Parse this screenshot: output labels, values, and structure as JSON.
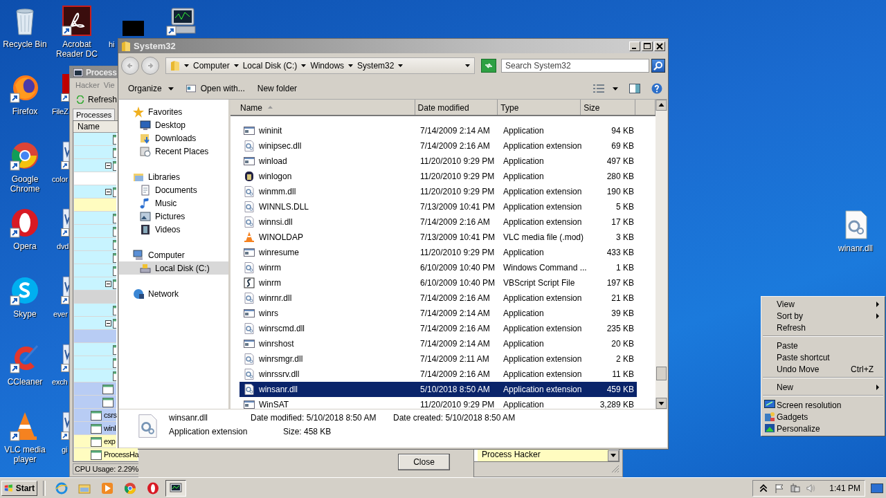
{
  "desktop_icons": [
    {
      "label": "Recycle Bin",
      "kind": "recycle",
      "shortcut": false
    },
    {
      "label": "Acrobat Reader DC",
      "kind": "acrobat",
      "shortcut": true
    },
    {
      "label": "hi",
      "kind": "blank",
      "shortcut": false
    },
    {
      "kind": "monitor",
      "shortcut": true
    },
    {
      "label": "Firefox",
      "kind": "firefox",
      "shortcut": true
    },
    {
      "label": "FileZ",
      "kind": "filezilla",
      "shortcut": true
    },
    {
      "label": "Google Chrome",
      "kind": "chrome",
      "shortcut": true
    },
    {
      "label": "color",
      "kind": "document",
      "shortcut": true
    },
    {
      "label": "Opera",
      "kind": "opera",
      "shortcut": true
    },
    {
      "label": "dvd",
      "kind": "document",
      "shortcut": true
    },
    {
      "label": "Skype",
      "kind": "skype",
      "shortcut": true
    },
    {
      "label": "ever",
      "kind": "document",
      "shortcut": true
    },
    {
      "label": "CCleaner",
      "kind": "ccleaner",
      "shortcut": true
    },
    {
      "label": "exch",
      "kind": "document",
      "shortcut": true
    },
    {
      "label": "VLC media player",
      "kind": "vlc",
      "shortcut": true
    },
    {
      "label": "gi",
      "kind": "document",
      "shortcut": true
    },
    {
      "label": "winanr.dll",
      "kind": "dll",
      "shortcut": false
    }
  ],
  "process_hacker": {
    "title": "Process",
    "menu": [
      "Hacker",
      "Vie"
    ],
    "toolbar": [
      "Refresh"
    ],
    "tabs": [
      {
        "label": "Processes",
        "selected": true
      }
    ],
    "column": "Name",
    "rows": [
      {
        "color": "#c8f4ff",
        "kind": "leaf",
        "icon": true
      },
      {
        "color": "#c8f4ff",
        "kind": "leaf",
        "icon": true
      },
      {
        "color": "#c8f4ff",
        "kind": "node",
        "icon": true
      },
      {
        "color": "#ffffff",
        "kind": "leaf",
        "icon": false
      },
      {
        "color": "#c8f4ff",
        "kind": "node",
        "icon": true
      },
      {
        "color": "#fffcc0",
        "kind": "leaf",
        "icon": false
      },
      {
        "color": "#c8f4ff",
        "kind": "leaf",
        "icon": true
      },
      {
        "color": "#c8f4ff",
        "kind": "leaf",
        "icon": true
      },
      {
        "color": "#c8f4ff",
        "kind": "leaf",
        "icon": true
      },
      {
        "color": "#c8f4ff",
        "kind": "leaf",
        "icon": true
      },
      {
        "color": "#c8f4ff",
        "kind": "leaf",
        "icon": true
      },
      {
        "color": "#c8f4ff",
        "kind": "node",
        "icon": true
      },
      {
        "color": "#d4d4d4",
        "kind": "leaf",
        "icon": false
      },
      {
        "color": "#c8f4ff",
        "kind": "leaf",
        "icon": true
      },
      {
        "color": "#c8f4ff",
        "kind": "node",
        "icon": true
      },
      {
        "color": "#b8ccf4",
        "kind": "leaf",
        "icon": false
      },
      {
        "color": "#c8f4ff",
        "kind": "leaf",
        "icon": true
      },
      {
        "color": "#c8f4ff",
        "kind": "leaf",
        "icon": true
      },
      {
        "color": "#c8f4ff",
        "kind": "leaf",
        "icon": true
      },
      {
        "color": "#b8ccf4",
        "kind": "leaf",
        "icon": true
      },
      {
        "color": "#b8ccf4",
        "kind": "leaf",
        "icon": true
      },
      {
        "color": "#b8ccf4",
        "kind": "leaf",
        "icon": true,
        "text": "csrs"
      },
      {
        "color": "#b8ccf4",
        "kind": "leaf",
        "icon": true,
        "text": "winl"
      },
      {
        "color": "#fffcc0",
        "kind": "leaf",
        "icon": true,
        "text": "exp"
      },
      {
        "color": "#fffcc0",
        "kind": "leaf",
        "icon": true,
        "text": "ProcessHa",
        "description": "Process Hacker"
      }
    ],
    "status": "CPU Usage: 2.29%"
  },
  "dialog": {
    "button": "Close"
  },
  "explorer": {
    "title": "System32",
    "breadcrumb": [
      "Computer",
      "Local Disk (C:)",
      "Windows",
      "System32"
    ],
    "search": {
      "placeholder": "Search System32"
    },
    "toolbar": [
      {
        "label": "Organize",
        "kind": "menu"
      },
      {
        "label": "Open with...",
        "kind": "open"
      },
      {
        "label": "New folder",
        "kind": "plain"
      }
    ],
    "nav": [
      {
        "label": "Favorites",
        "kind": "star",
        "selected": false,
        "children": [
          {
            "label": "Desktop",
            "kind": "desktop",
            "selected": false
          },
          {
            "label": "Downloads",
            "kind": "downloads",
            "selected": false
          },
          {
            "label": "Recent Places",
            "kind": "recent",
            "selected": false
          }
        ]
      },
      {
        "label": "Libraries",
        "kind": "libraries",
        "selected": false,
        "children": [
          {
            "label": "Documents",
            "kind": "documents",
            "selected": false
          },
          {
            "label": "Music",
            "kind": "music",
            "selected": false
          },
          {
            "label": "Pictures",
            "kind": "pictures",
            "selected": false
          },
          {
            "label": "Videos",
            "kind": "videos",
            "selected": false
          }
        ]
      },
      {
        "label": "Computer",
        "kind": "computer",
        "selected": false,
        "children": [
          {
            "label": "Local Disk (C:)",
            "kind": "disk",
            "selected": true
          }
        ]
      },
      {
        "label": "Network",
        "kind": "network",
        "selected": false
      }
    ],
    "columns": [
      {
        "label": "Name",
        "sorted": true
      },
      {
        "label": "Date modified",
        "sorted": false
      },
      {
        "label": "Type",
        "sorted": false
      },
      {
        "label": "Size",
        "sorted": false
      }
    ],
    "files": [
      {
        "name": "wininit",
        "date": "7/14/2009 2:14 AM",
        "type": "Application",
        "size": "94 KB",
        "kind": "application",
        "selected": false
      },
      {
        "name": "winipsec.dll",
        "date": "7/14/2009 2:16 AM",
        "type": "Application extension",
        "size": "69 KB",
        "kind": "extension",
        "selected": false
      },
      {
        "name": "winload",
        "date": "11/20/2010 9:29 PM",
        "type": "Application",
        "size": "497 KB",
        "kind": "application",
        "selected": false
      },
      {
        "name": "winlogon",
        "date": "11/20/2010 9:29 PM",
        "type": "Application",
        "size": "280 KB",
        "kind": "logon",
        "selected": false
      },
      {
        "name": "winmm.dll",
        "date": "11/20/2010 9:29 PM",
        "type": "Application extension",
        "size": "190 KB",
        "kind": "extension",
        "selected": false
      },
      {
        "name": "WINNLS.DLL",
        "date": "7/13/2009 10:41 PM",
        "type": "Application extension",
        "size": "5 KB",
        "kind": "extension",
        "selected": false
      },
      {
        "name": "winnsi.dll",
        "date": "7/14/2009 2:16 AM",
        "type": "Application extension",
        "size": "17 KB",
        "kind": "extension",
        "selected": false
      },
      {
        "name": "WINOLDAP",
        "date": "7/13/2009 10:41 PM",
        "type": "VLC media file (.mod)",
        "size": "3 KB",
        "kind": "media",
        "selected": false
      },
      {
        "name": "winresume",
        "date": "11/20/2010 9:29 PM",
        "type": "Application",
        "size": "433 KB",
        "kind": "application",
        "selected": false
      },
      {
        "name": "winrm",
        "date": "6/10/2009 10:40 PM",
        "type": "Windows Command ...",
        "size": "1 KB",
        "kind": "command",
        "selected": false
      },
      {
        "name": "winrm",
        "date": "6/10/2009 10:40 PM",
        "type": "VBScript Script File",
        "size": "197 KB",
        "kind": "script",
        "selected": false
      },
      {
        "name": "winrnr.dll",
        "date": "7/14/2009 2:16 AM",
        "type": "Application extension",
        "size": "21 KB",
        "kind": "extension",
        "selected": false
      },
      {
        "name": "winrs",
        "date": "7/14/2009 2:14 AM",
        "type": "Application",
        "size": "39 KB",
        "kind": "application",
        "selected": false
      },
      {
        "name": "winrscmd.dll",
        "date": "7/14/2009 2:16 AM",
        "type": "Application extension",
        "size": "235 KB",
        "kind": "extension",
        "selected": false
      },
      {
        "name": "winrshost",
        "date": "7/14/2009 2:14 AM",
        "type": "Application",
        "size": "20 KB",
        "kind": "application",
        "selected": false
      },
      {
        "name": "winrsmgr.dll",
        "date": "7/14/2009 2:11 AM",
        "type": "Application extension",
        "size": "2 KB",
        "kind": "extension",
        "selected": false
      },
      {
        "name": "winrssrv.dll",
        "date": "7/14/2009 2:16 AM",
        "type": "Application extension",
        "size": "11 KB",
        "kind": "extension",
        "selected": false
      },
      {
        "name": "winsanr.dll",
        "date": "5/10/2018 8:50 AM",
        "type": "Application extension",
        "size": "459 KB",
        "kind": "extension",
        "selected": true
      },
      {
        "name": "WinSAT",
        "date": "11/20/2010 9:29 PM",
        "type": "Application",
        "size": "3,289 KB",
        "kind": "application",
        "selected": false
      }
    ],
    "details": {
      "name": "winsanr.dll",
      "type": "Application extension",
      "modified": "Date modified: 5/10/2018 8:50 AM",
      "size": "Size: 458 KB",
      "created": "Date created: 5/10/2018 8:50 AM"
    }
  },
  "context_menu": [
    {
      "kind": "item",
      "label": "View",
      "submenu": true
    },
    {
      "kind": "item",
      "label": "Sort by",
      "submenu": true
    },
    {
      "kind": "item",
      "label": "Refresh",
      "submenu": false
    },
    {
      "kind": "separator"
    },
    {
      "kind": "item",
      "label": "Paste",
      "submenu": false
    },
    {
      "kind": "item",
      "label": "Paste shortcut",
      "submenu": false
    },
    {
      "kind": "item",
      "label": "Undo Move",
      "shortcut": "Ctrl+Z",
      "submenu": false
    },
    {
      "kind": "separator"
    },
    {
      "kind": "item",
      "label": "New",
      "submenu": true
    },
    {
      "kind": "separator"
    },
    {
      "kind": "icon-item",
      "label": "Screen resolution",
      "submenu": false
    },
    {
      "kind": "icon-item",
      "label": "Gadgets",
      "submenu": false
    },
    {
      "kind": "icon-item",
      "label": "Personalize",
      "submenu": false
    }
  ],
  "taskbar": {
    "start": "Start",
    "apps": [
      {
        "kind": "ie",
        "active": false
      },
      {
        "kind": "folder",
        "active": false
      },
      {
        "kind": "media",
        "active": false
      },
      {
        "kind": "chrome",
        "active": false
      },
      {
        "kind": "opera",
        "active": false
      },
      {
        "kind": "processhacker",
        "active": true
      }
    ],
    "time": "1:41 PM"
  }
}
